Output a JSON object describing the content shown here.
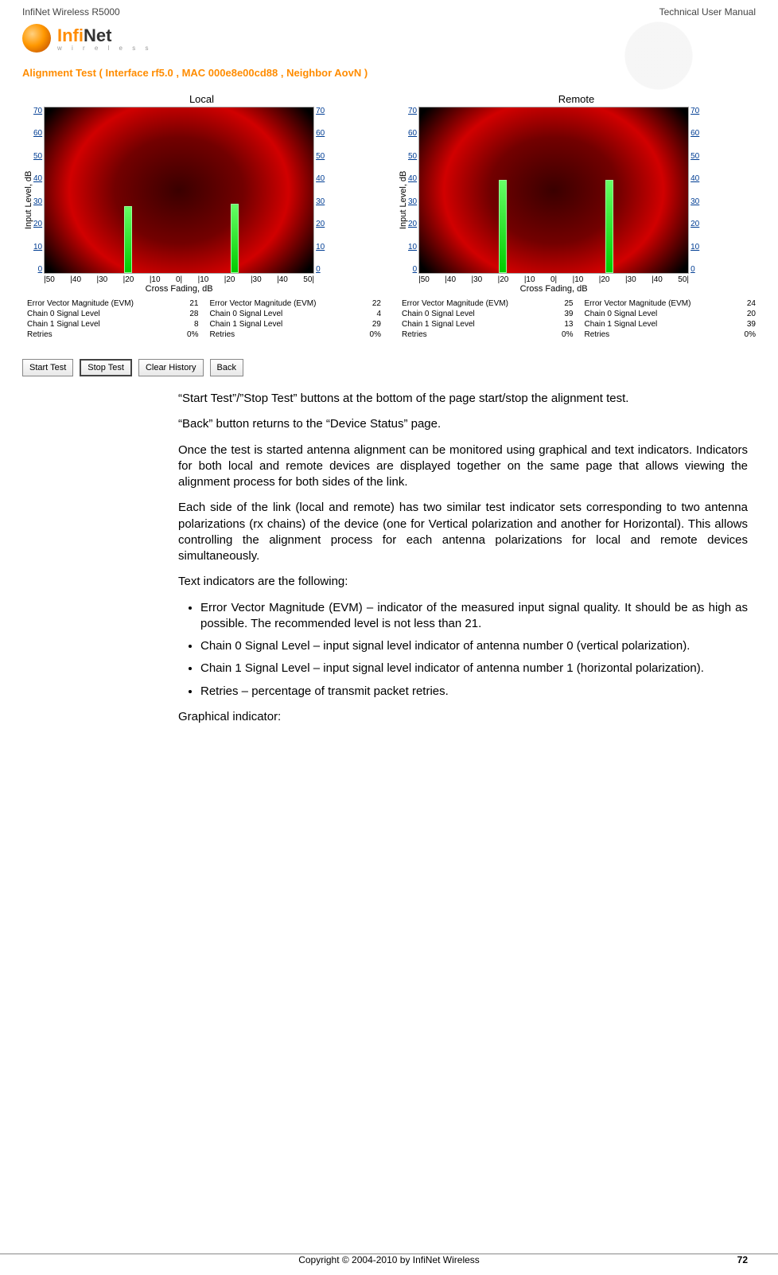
{
  "header": {
    "left": "InfiNet Wireless R5000",
    "right": "Technical User Manual"
  },
  "logo": {
    "main_a": "Infi",
    "main_b": "Net",
    "sub": "w i r e l e s s"
  },
  "alignment_test_title": "Alignment Test ( Interface rf5.0 , MAC 000e8e00cd88 , Neighbor AovN )",
  "axes": {
    "y_label": "Input Level, dB",
    "x_label": "Cross Fading, dB",
    "y_ticks": [
      "70",
      "60",
      "50",
      "40",
      "30",
      "20",
      "10",
      "0"
    ],
    "x_ticks": [
      "|50",
      "|40",
      "|30",
      "|20",
      "|10",
      "0|",
      "|10",
      "|20",
      "|30",
      "|40",
      "50|"
    ]
  },
  "local": {
    "title": "Local",
    "left": {
      "evm_label": "Error Vector Magnitude (EVM)",
      "evm": "21",
      "c0_label": "Chain 0 Signal Level",
      "c0": "28",
      "c1_label": "Chain 1 Signal Level",
      "c1": "8",
      "ret_label": "Retries",
      "ret": "0%"
    },
    "right": {
      "evm_label": "Error Vector Magnitude (EVM)",
      "evm": "22",
      "c0_label": "Chain 0 Signal Level",
      "c0": "4",
      "c1_label": "Chain 1 Signal Level",
      "c1": "29",
      "ret_label": "Retries",
      "ret": "0%"
    }
  },
  "remote": {
    "title": "Remote",
    "left": {
      "evm_label": "Error Vector Magnitude (EVM)",
      "evm": "25",
      "c0_label": "Chain 0 Signal Level",
      "c0": "39",
      "c1_label": "Chain 1 Signal Level",
      "c1": "13",
      "ret_label": "Retries",
      "ret": "0%"
    },
    "right": {
      "evm_label": "Error Vector Magnitude (EVM)",
      "evm": "24",
      "c0_label": "Chain 0 Signal Level",
      "c0": "20",
      "c1_label": "Chain 1 Signal Level",
      "c1": "39",
      "ret_label": "Retries",
      "ret": "0%"
    }
  },
  "buttons": {
    "start": "Start Test",
    "stop": "Stop Test",
    "clear": "Clear History",
    "back": "Back"
  },
  "body": {
    "p1": "“Start Test”/”Stop Test” buttons at the bottom of the page start/stop the alignment test.",
    "p2": "“Back” button returns to the “Device Status” page.",
    "p3": "Once the test is started antenna alignment can be monitored using graphical and text indicators. Indicators for both local and remote devices are displayed together on the same page that allows viewing the alignment process for both sides of the link.",
    "p4": "Each side of the link (local and remote) has two similar test indicator sets corresponding to two antenna polarizations (rx chains) of the device (one for Vertical polarization and another for Horizontal). This allows controlling the alignment process for each antenna polarizations for local and remote devices simultaneously.",
    "p5": "Text indicators are the following:",
    "li1": "Error Vector Magnitude (EVM) – indicator of the measured input signal quality. It should be as high as possible. The recommended level is not less than 21.",
    "li2": "Chain 0 Signal Level – input signal level indicator of antenna number 0 (vertical polarization).",
    "li3": "Chain 1 Signal Level – input signal level indicator of antenna number 1 (horizontal polarization).",
    "li4": "Retries – percentage of transmit packet retries.",
    "p6": "Graphical indicator:"
  },
  "footer": {
    "copy": "Copyright © 2004-2010 by InfiNet Wireless",
    "page": "72"
  },
  "chart_data": [
    {
      "type": "bar",
      "title": "Local",
      "xlabel": "Cross Fading, dB",
      "ylabel": "Input Level, dB",
      "ylim": [
        0,
        70
      ],
      "series": [
        {
          "name": "left",
          "x": -20,
          "value": 28
        },
        {
          "name": "right",
          "x": 20,
          "value": 29
        }
      ]
    },
    {
      "type": "bar",
      "title": "Remote",
      "xlabel": "Cross Fading, dB",
      "ylabel": "Input Level, dB",
      "ylim": [
        0,
        70
      ],
      "series": [
        {
          "name": "left",
          "x": -20,
          "value": 39
        },
        {
          "name": "right",
          "x": 20,
          "value": 39
        }
      ]
    }
  ]
}
